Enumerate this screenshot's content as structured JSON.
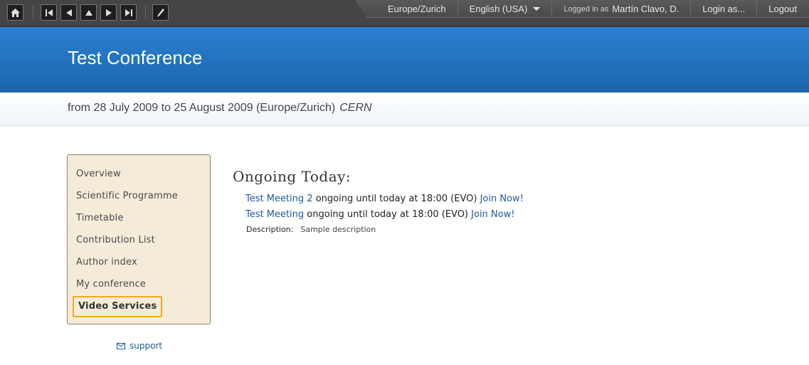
{
  "toolbar": {
    "icons": [
      "home-icon",
      "first-icon",
      "previous-icon",
      "up-icon",
      "next-icon",
      "last-icon",
      "edit-icon"
    ],
    "timezone": "Europe/Zurich",
    "language": "English (USA)",
    "logged_in_prefix": "Logged in as",
    "user": "Martín Clavo, D.",
    "login_as": "Login as...",
    "logout": "Logout"
  },
  "conference": {
    "title": "Test Conference",
    "dates": "from 28 July 2009 to 25 August 2009 (Europe/Zurich)",
    "location": "CERN"
  },
  "menu": {
    "items": [
      "Overview",
      "Scientific Programme",
      "Timetable",
      "Contribution List",
      "Author index",
      "My conference"
    ],
    "active": "Video Services",
    "support": "support"
  },
  "main": {
    "heading": "Ongoing Today:",
    "meetings": [
      {
        "name": "Test Meeting 2",
        "status": "ongoing until today at 18:00 (EVO)",
        "join": "Join Now!"
      },
      {
        "name": "Test Meeting",
        "status": "ongoing until today at 18:00 (EVO)",
        "join": "Join Now!"
      }
    ],
    "description_label": "Description:",
    "description_value": "Sample description"
  }
}
